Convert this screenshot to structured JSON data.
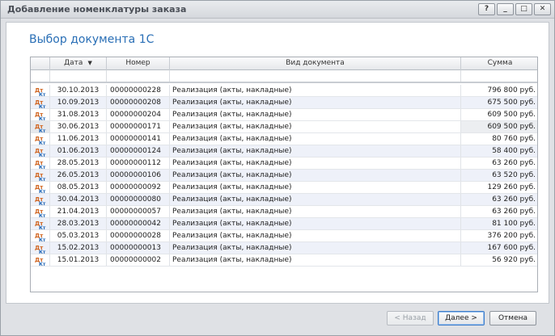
{
  "window": {
    "title": "Добавление номенклатуры заказа",
    "controls": [
      "?",
      "_",
      "□",
      "✕"
    ]
  },
  "heading": "Выбор документа 1С",
  "table": {
    "columns": [
      {
        "key": "date",
        "label": "Дата"
      },
      {
        "key": "number",
        "label": "Номер"
      },
      {
        "key": "type",
        "label": "Вид документа"
      },
      {
        "key": "sum",
        "label": "Сумма"
      }
    ],
    "sort_indicator": "▼",
    "selected_row": 3,
    "rows": [
      {
        "date": "30.10.2013",
        "number": "00000000228",
        "type": "Реализация (акты, накладные)",
        "sum": "796 800 руб."
      },
      {
        "date": "10.09.2013",
        "number": "00000000208",
        "type": "Реализация (акты, накладные)",
        "sum": "675 500 руб."
      },
      {
        "date": "31.08.2013",
        "number": "00000000204",
        "type": "Реализация (акты, накладные)",
        "sum": "609 500 руб."
      },
      {
        "date": "30.06.2013",
        "number": "00000000171",
        "type": "Реализация (акты, накладные)",
        "sum": "609 500 руб."
      },
      {
        "date": "11.06.2013",
        "number": "00000000141",
        "type": "Реализация (акты, накладные)",
        "sum": "80 760 руб."
      },
      {
        "date": "01.06.2013",
        "number": "00000000124",
        "type": "Реализация (акты, накладные)",
        "sum": "58 400 руб."
      },
      {
        "date": "28.05.2013",
        "number": "00000000112",
        "type": "Реализация (акты, накладные)",
        "sum": "63 260 руб."
      },
      {
        "date": "26.05.2013",
        "number": "00000000106",
        "type": "Реализация (акты, накладные)",
        "sum": "63 520 руб."
      },
      {
        "date": "08.05.2013",
        "number": "00000000092",
        "type": "Реализация (акты, накладные)",
        "sum": "129 260 руб."
      },
      {
        "date": "30.04.2013",
        "number": "00000000080",
        "type": "Реализация (акты, накладные)",
        "sum": "63 260 руб."
      },
      {
        "date": "21.04.2013",
        "number": "00000000057",
        "type": "Реализация (акты, накладные)",
        "sum": "63 260 руб."
      },
      {
        "date": "28.03.2013",
        "number": "00000000042",
        "type": "Реализация (акты, накладные)",
        "sum": "81 100 руб."
      },
      {
        "date": "05.03.2013",
        "number": "00000000028",
        "type": "Реализация (акты, накладные)",
        "sum": "376 200 руб."
      },
      {
        "date": "15.02.2013",
        "number": "00000000013",
        "type": "Реализация (акты, накладные)",
        "sum": "167 600 руб."
      },
      {
        "date": "15.01.2013",
        "number": "00000000002",
        "type": "Реализация (акты, накладные)",
        "sum": "56 920 руб."
      }
    ],
    "row_icon": {
      "name": "debit-credit-icon",
      "top": "Дт",
      "bottom": "Кт"
    }
  },
  "buttons": {
    "back": "< Назад",
    "next": "Далее >",
    "cancel": "Отмена"
  }
}
